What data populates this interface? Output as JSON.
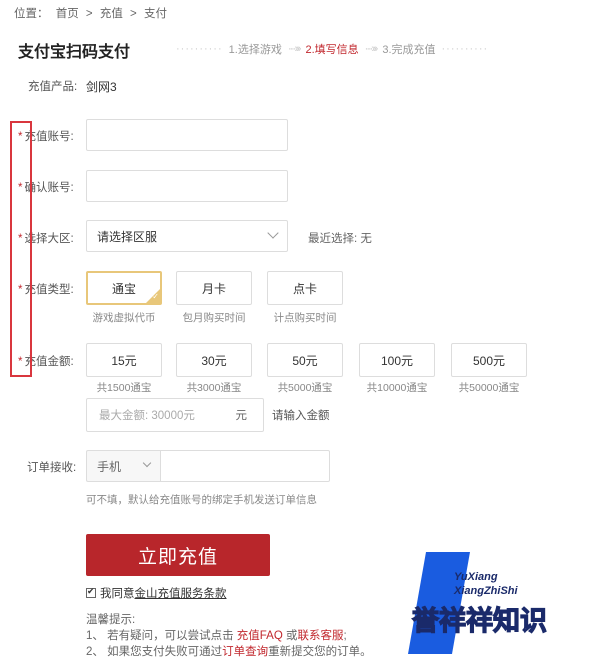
{
  "breadcrumb": {
    "prefix": "位置：",
    "items": [
      "首页",
      ">",
      "充值",
      ">",
      "支付"
    ]
  },
  "title": "支付宝扫码支付",
  "steps": [
    {
      "label": "1.选择游戏",
      "active": false
    },
    {
      "label": "2.填写信息",
      "active": true
    },
    {
      "label": "3.完成充值",
      "active": false
    }
  ],
  "form": {
    "product_label": "充值产品:",
    "product_value": "剑网3",
    "required_mark": "*",
    "account_label": "充值账号:",
    "confirm_label": "确认账号:",
    "region_label": "选择大区:",
    "region_placeholder": "请选择区服",
    "recent_label": "最近选择: 无",
    "type_label": "充值类型:",
    "types": [
      {
        "name": "通宝",
        "sub": "游戏虚拟代币",
        "selected": true
      },
      {
        "name": "月卡",
        "sub": "包月购买时间",
        "selected": false
      },
      {
        "name": "点卡",
        "sub": "计点购买时间",
        "selected": false
      }
    ],
    "amount_label": "充值金额:",
    "amounts": [
      {
        "value": "15元",
        "sub": "共1500通宝"
      },
      {
        "value": "30元",
        "sub": "共3000通宝"
      },
      {
        "value": "50元",
        "sub": "共5000通宝"
      },
      {
        "value": "100元",
        "sub": "共10000通宝"
      },
      {
        "value": "500元",
        "sub": "共50000通宝"
      }
    ],
    "max_amount_placeholder": "最大金额: 30000元",
    "max_amount_unit": "元",
    "max_amount_hint": "请输入金额",
    "order_label": "订单接收:",
    "phone_option": "手机",
    "order_note": "可不填，默认给充值账号的绑定手机发送订单信息",
    "submit_label": "立即充值",
    "agree_text": "我同意",
    "agree_link": "金山充值服务条款"
  },
  "tips": {
    "title": "温馨提示:",
    "line1_num": "1、",
    "line1_text": " 若有疑问，可以尝试点击 ",
    "line1_link1": "充值FAQ",
    "line1_mid": " 或",
    "line1_link2": "联系客服",
    "line1_end": ";",
    "line2_num": "2、",
    "line2_text": " 如果您支付失败可通过",
    "line2_link": "订单查询",
    "line2_end": "重新提交您的订单。"
  },
  "watermark": {
    "line1": "YuXiang",
    "line2": "XiangZhiShi",
    "main": "誉祥祥知识"
  },
  "colors": {
    "accent": "#b8262b",
    "selected_border": "#e8c77a",
    "highlight_box": "#d9363e",
    "watermark_blue": "#1a5ce0"
  }
}
